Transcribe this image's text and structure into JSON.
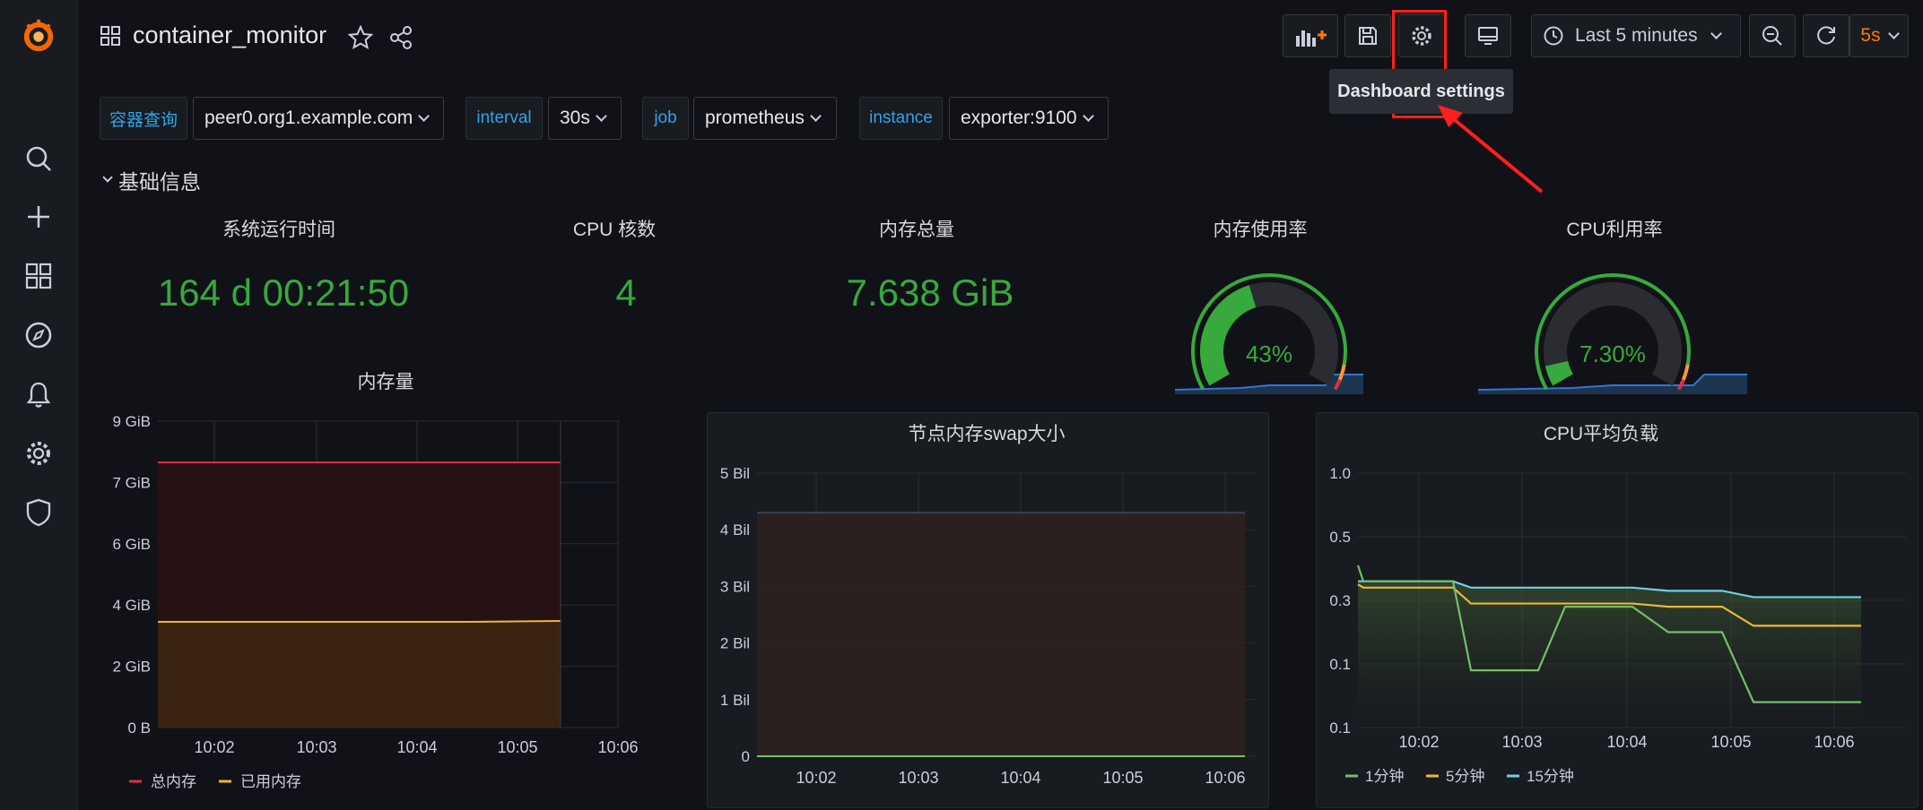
{
  "nav": {
    "dashboard_title": "container_monitor",
    "time_range": "Last 5 minutes",
    "refresh_interval": "5s",
    "tooltip": "Dashboard settings"
  },
  "variables": [
    {
      "label": "容器查询",
      "value": "peer0.org1.example.com"
    },
    {
      "label": "interval",
      "value": "30s"
    },
    {
      "label": "job",
      "value": "prometheus"
    },
    {
      "label": "instance",
      "value": "exporter:9100"
    }
  ],
  "row": {
    "title": "基础信息"
  },
  "stats": [
    {
      "title": "系统运行时间",
      "value": "164 d 00:21:50"
    },
    {
      "title": "CPU 核数",
      "value": "4"
    },
    {
      "title": "内存总量",
      "value": "7.638 GiB"
    }
  ],
  "gauges": [
    {
      "title": "内存使用率",
      "value_text": "43%",
      "fraction": 0.43
    },
    {
      "title": "CPU利用率",
      "value_text": "7.30%",
      "fraction": 0.073
    }
  ],
  "colors": {
    "green": "#37a93d",
    "accent_blue": "#33a2e5",
    "refresh_orange": "#ff780a",
    "highlight_red": "#ff1f1f"
  },
  "chart_data": [
    {
      "type": "area",
      "title": "内存量",
      "x": [
        "10:02",
        "10:03",
        "10:04",
        "10:05",
        "10:06"
      ],
      "yticks": [
        "0 B",
        "2 GiB",
        "4 GiB",
        "6 GiB",
        "7 GiB",
        "9 GiB"
      ],
      "ylim": [
        0,
        9
      ],
      "series": [
        {
          "name": "总内存",
          "color": "#e02f44",
          "values": [
            7.1,
            7.1,
            7.1,
            7.1,
            7.1,
            7.1
          ]
        },
        {
          "name": "已用内存",
          "color": "#eab839",
          "values": [
            3.45,
            3.45,
            3.45,
            3.45,
            3.45,
            3.46
          ]
        }
      ],
      "x_points": [
        9.6,
        10.0,
        10.4,
        10.8,
        11.2,
        11.6
      ],
      "legend": "bottom"
    },
    {
      "type": "area",
      "title": "节点内存swap大小",
      "x": [
        "10:02",
        "10:03",
        "10:04",
        "10:05",
        "10:06"
      ],
      "yticks": [
        "0",
        "1 Bil",
        "2 Bil",
        "3 Bil",
        "4 Bil",
        "5 Bil"
      ],
      "ylim": [
        0,
        5
      ],
      "series": [
        {
          "color": "#8ab8ff",
          "values": [
            4.3,
            4.3,
            4.3,
            4.3,
            4.3
          ]
        },
        {
          "color": "#73bf69",
          "values": [
            0,
            0,
            0,
            0,
            0
          ]
        }
      ],
      "legend": "none"
    },
    {
      "type": "line",
      "title": "CPU平均负载",
      "x": [
        "10:02",
        "10:03",
        "10:04",
        "10:05",
        "10:06"
      ],
      "yticks": [
        "0.1",
        "0.1",
        "0.3",
        "0.5",
        "1.0"
      ],
      "series": [
        {
          "name": "1分钟",
          "color": "#73bf69",
          "values": [
            0.41,
            0.36,
            0.36,
            0.36,
            0.09,
            0.09,
            0.09,
            0.28,
            0.28,
            0.28,
            0.2,
            0.2,
            0.2,
            0.04,
            0.04,
            0.04
          ]
        },
        {
          "name": "5分钟",
          "color": "#eab839",
          "values": [
            0.35,
            0.34,
            0.34,
            0.34,
            0.29,
            0.29,
            0.29,
            0.29,
            0.29,
            0.29,
            0.28,
            0.28,
            0.28,
            0.22,
            0.22,
            0.22
          ]
        },
        {
          "name": "15分钟",
          "color": "#6ed0e0",
          "values": [
            0.36,
            0.36,
            0.36,
            0.36,
            0.34,
            0.34,
            0.34,
            0.34,
            0.34,
            0.34,
            0.33,
            0.33,
            0.33,
            0.31,
            0.31,
            0.31
          ]
        }
      ],
      "legend": "bottom"
    }
  ]
}
